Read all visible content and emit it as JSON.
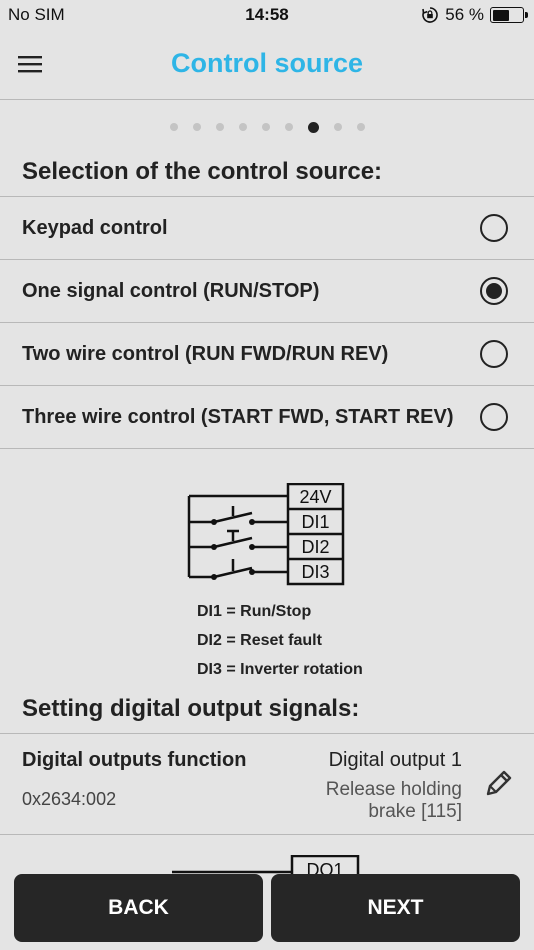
{
  "status": {
    "carrier": "No SIM",
    "time": "14:58",
    "battery": "56 %",
    "battery_level": 0.56
  },
  "header": {
    "title": "Control source"
  },
  "pager": {
    "count": 9,
    "active_index": 6
  },
  "control_section": {
    "title": "Selection of the control source:",
    "options": [
      {
        "label": "Keypad control",
        "selected": false
      },
      {
        "label": "One signal control (RUN/STOP)",
        "selected": true
      },
      {
        "label": "Two wire control (RUN FWD/RUN REV)",
        "selected": false
      },
      {
        "label": "Three wire control (START FWD, START REV)",
        "selected": false
      }
    ]
  },
  "diagram": {
    "terminals": [
      "24V",
      "DI1",
      "DI2",
      "DI3"
    ],
    "legend": [
      "DI1 = Run/Stop",
      "DI2 = Reset fault",
      "DI3 = Inverter rotation"
    ]
  },
  "digital_outputs": {
    "title": "Setting digital output signals:",
    "label": "Digital outputs function",
    "code": "0x2634:002",
    "output_name": "Digital output 1",
    "value": "Release holding brake [115]",
    "peek_terminal": "DO1"
  },
  "footer": {
    "back_label": "BACK",
    "next_label": "NEXT"
  }
}
